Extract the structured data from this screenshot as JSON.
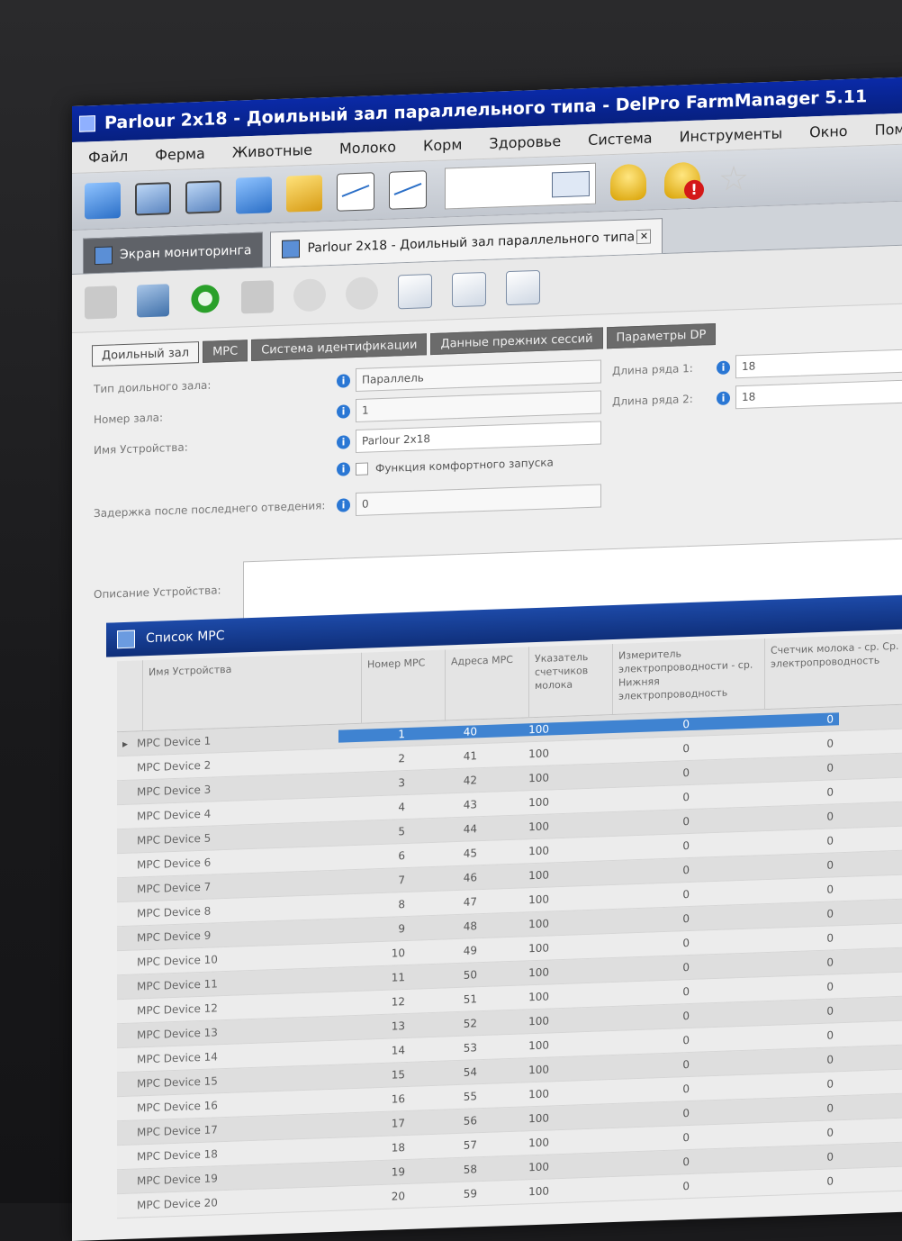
{
  "window": {
    "title": "Parlour 2x18 - Доильный зал параллельного типа - DelPro FarmManager 5.11"
  },
  "menu": [
    "Файл",
    "Ферма",
    "Животные",
    "Молоко",
    "Корм",
    "Здоровье",
    "Система",
    "Инструменты",
    "Окно",
    "Помощь!"
  ],
  "tabs": {
    "home": "Экран мониторинга",
    "active": "Parlour 2x18 - Доильный зал параллельного типа"
  },
  "form_tabs": [
    "Доильный зал",
    "MPC",
    "Система идентификации",
    "Данные прежних сессий",
    "Параметры DP"
  ],
  "form": {
    "parlour_type_label": "Тип доильного зала:",
    "parlour_type_value": "Параллель",
    "parlour_number_label": "Номер зала:",
    "parlour_number_value": "1",
    "device_name_label": "Имя Устройства:",
    "device_name_value": "Parlour 2x18",
    "comfort_start_label": "Функция комфортного запуска",
    "delay_label": "Задержка после последнего отведения:",
    "delay_value": "0",
    "row1_length_label": "Длина ряда 1:",
    "row1_length_value": "18",
    "row2_length_label": "Длина ряда 2:",
    "row2_length_value": "18",
    "description_label": "Описание Устройства:"
  },
  "grid": {
    "title": "Список MPC",
    "columns": {
      "name": "Имя Устройства",
      "number": "Номер MPC",
      "address": "Адреса MPC",
      "pointer": "Указатель счетчиков молока",
      "conductivity": "Измеритель электропроводности - ср. Нижняя электропроводность",
      "counter": "Счетчик молока - ср. Ср. электропроводность"
    },
    "rows": [
      {
        "name": "MPC Device 1",
        "number": "1",
        "address": "40",
        "pointer": "100",
        "cond": "0",
        "counter": "0"
      },
      {
        "name": "MPC Device 2",
        "number": "2",
        "address": "41",
        "pointer": "100",
        "cond": "0",
        "counter": "0"
      },
      {
        "name": "MPC Device 3",
        "number": "3",
        "address": "42",
        "pointer": "100",
        "cond": "0",
        "counter": "0"
      },
      {
        "name": "MPC Device 4",
        "number": "4",
        "address": "43",
        "pointer": "100",
        "cond": "0",
        "counter": "0"
      },
      {
        "name": "MPC Device 5",
        "number": "5",
        "address": "44",
        "pointer": "100",
        "cond": "0",
        "counter": "0"
      },
      {
        "name": "MPC Device 6",
        "number": "6",
        "address": "45",
        "pointer": "100",
        "cond": "0",
        "counter": "0"
      },
      {
        "name": "MPC Device 7",
        "number": "7",
        "address": "46",
        "pointer": "100",
        "cond": "0",
        "counter": "0"
      },
      {
        "name": "MPC Device 8",
        "number": "8",
        "address": "47",
        "pointer": "100",
        "cond": "0",
        "counter": "0"
      },
      {
        "name": "MPC Device 9",
        "number": "9",
        "address": "48",
        "pointer": "100",
        "cond": "0",
        "counter": "0"
      },
      {
        "name": "MPC Device 10",
        "number": "10",
        "address": "49",
        "pointer": "100",
        "cond": "0",
        "counter": "0"
      },
      {
        "name": "MPC Device 11",
        "number": "11",
        "address": "50",
        "pointer": "100",
        "cond": "0",
        "counter": "0"
      },
      {
        "name": "MPC Device 12",
        "number": "12",
        "address": "51",
        "pointer": "100",
        "cond": "0",
        "counter": "0"
      },
      {
        "name": "MPC Device 13",
        "number": "13",
        "address": "52",
        "pointer": "100",
        "cond": "0",
        "counter": "0"
      },
      {
        "name": "MPC Device 14",
        "number": "14",
        "address": "53",
        "pointer": "100",
        "cond": "0",
        "counter": "0"
      },
      {
        "name": "MPC Device 15",
        "number": "15",
        "address": "54",
        "pointer": "100",
        "cond": "0",
        "counter": "0"
      },
      {
        "name": "MPC Device 16",
        "number": "16",
        "address": "55",
        "pointer": "100",
        "cond": "0",
        "counter": "0"
      },
      {
        "name": "MPC Device 17",
        "number": "17",
        "address": "56",
        "pointer": "100",
        "cond": "0",
        "counter": "0"
      },
      {
        "name": "MPC Device 18",
        "number": "18",
        "address": "57",
        "pointer": "100",
        "cond": "0",
        "counter": "0"
      },
      {
        "name": "MPC Device 19",
        "number": "19",
        "address": "58",
        "pointer": "100",
        "cond": "0",
        "counter": "0"
      },
      {
        "name": "MPC Device 20",
        "number": "20",
        "address": "59",
        "pointer": "100",
        "cond": "0",
        "counter": "0"
      }
    ]
  }
}
